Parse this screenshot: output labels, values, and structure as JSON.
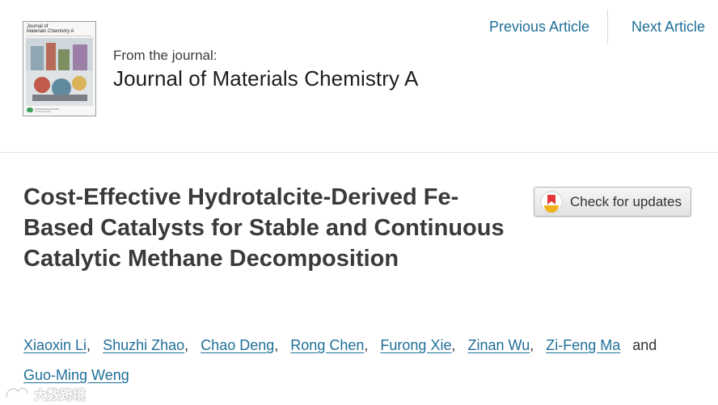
{
  "journal": {
    "from_label": "From the journal:",
    "name": "Journal of Materials Chemistry A",
    "cover_title_line1": "Journal of",
    "cover_title_line2": "Materials Chemistry A"
  },
  "nav": {
    "previous": "Previous Article",
    "next": "Next Article"
  },
  "article": {
    "title": "Cost-Effective Hydrotalcite-Derived Fe-Based Catalysts for Stable and Continuous Catalytic Methane Decomposition"
  },
  "check_updates": {
    "label": "Check for updates",
    "icon": "crossmark-icon"
  },
  "authors": {
    "list": [
      "Xiaoxin Li",
      "Shuzhi Zhao",
      "Chao Deng",
      "Rong Chen",
      "Furong Xie",
      "Zinan Wu",
      "Zi-Feng Ma"
    ],
    "last": "Guo-Ming Weng",
    "separator": ",",
    "conjunction": "and"
  },
  "watermark": {
    "text": "大数跨境"
  },
  "colors": {
    "link": "#1f6f99",
    "title": "#3a3a3a",
    "crossmark_red": "#e2373a",
    "crossmark_yellow": "#f2b21b"
  }
}
